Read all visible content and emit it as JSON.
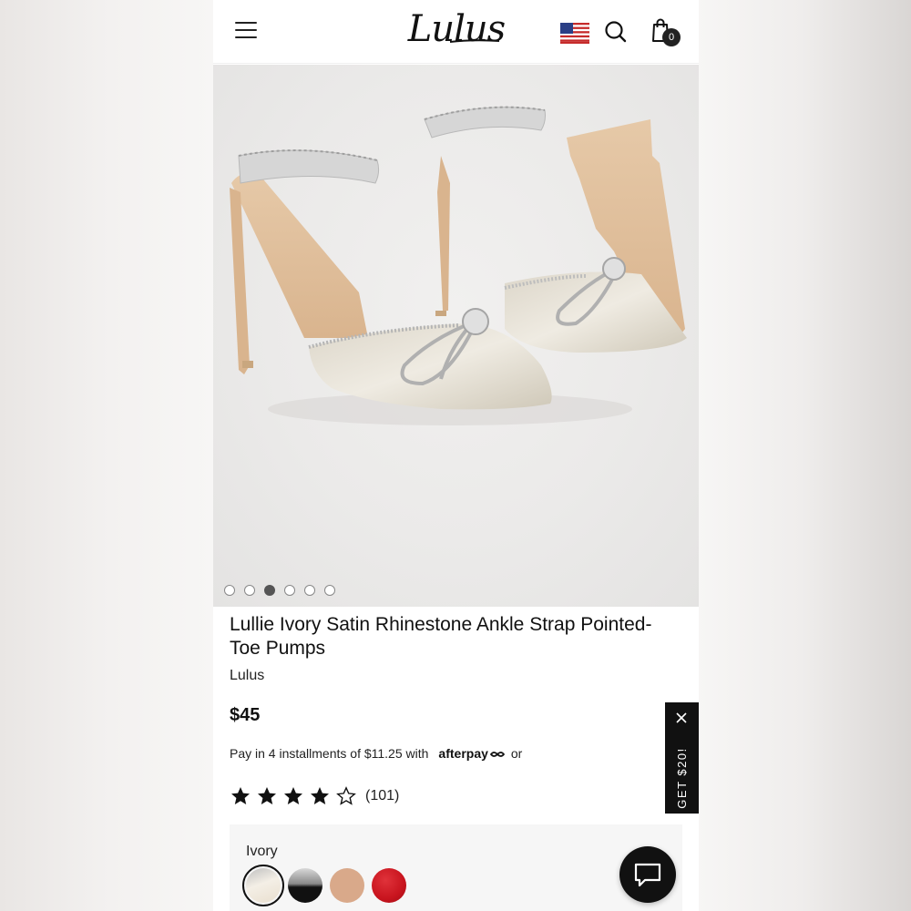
{
  "header": {
    "logo": "Lulus",
    "bag_count": "0"
  },
  "gallery": {
    "image_count": 6,
    "active_index": 2
  },
  "product": {
    "title": "Lullie Ivory Satin Rhinestone Ankle Strap Pointed-Toe Pumps",
    "brand": "Lulus",
    "price": "$45",
    "installments_text": "Pay in 4 installments of $11.25 with",
    "afterpay_label": "afterpay",
    "or_text": "or",
    "rating": 4,
    "rating_max": 5,
    "review_count": "(101)"
  },
  "color": {
    "selected_label": "Ivory",
    "swatches": [
      {
        "name": "Ivory",
        "color": "#e9e5df",
        "selected": true
      },
      {
        "name": "Black/Silver",
        "color": "#1a1a1a",
        "selected": false
      },
      {
        "name": "Nude",
        "color": "#d9a98a",
        "selected": false
      },
      {
        "name": "Red",
        "color": "#c8141e",
        "selected": false
      }
    ]
  },
  "promo": {
    "label": "GET $20!"
  },
  "colors": {
    "text": "#111111",
    "accent": "#111111"
  }
}
